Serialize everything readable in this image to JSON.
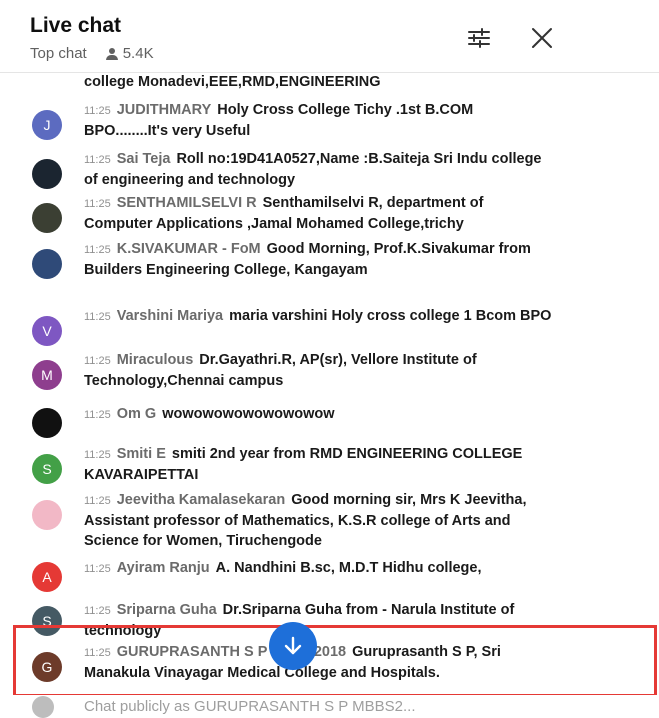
{
  "header": {
    "title": "Live chat",
    "mode": "Top chat",
    "viewers": "5.4K"
  },
  "messages": [
    {
      "time": "",
      "author": "",
      "text": "college   Monadevi,EEE,RMD,ENGINEERING",
      "avatar": null
    },
    {
      "time": "11:25",
      "author": "JUDITHMARY",
      "text": "Holy Cross College Tichy .1st B.COM BPO........It's very Useful",
      "avatar": {
        "letter": "J",
        "color": "#5c6bc0"
      }
    },
    {
      "time": "11:25",
      "author": "Sai Teja",
      "text": "Roll no:19D41A0527,Name :B.Saiteja Sri Indu college of engineering and technology",
      "avatar": {
        "letter": "",
        "color": "#1b2530"
      }
    },
    {
      "time": "11:25",
      "author": "SENTHAMILSELVI R",
      "text": "Senthamilselvi R, department of Computer Applications ,Jamal Mohamed College,trichy",
      "avatar": {
        "letter": "",
        "color": "#3b3f33"
      }
    },
    {
      "time": "11:25",
      "author": "K.SIVAKUMAR - FoM",
      "text": "Good Morning, Prof.K.Sivakumar from Builders Engineering College, Kangayam",
      "avatar": {
        "letter": "",
        "color": "#2f4a78"
      }
    },
    {
      "time": "11:25",
      "author": "Varshini Mariya",
      "text": "maria varshini Holy cross college 1 Bcom BPO",
      "avatar": {
        "letter": "V",
        "color": "#7e57c2"
      }
    },
    {
      "time": "11:25",
      "author": "Miraculous",
      "text": "Dr.Gayathri.R, AP(sr), Vellore Institute of Technology,Chennai campus",
      "avatar": {
        "letter": "M",
        "color": "#8e3e8e"
      }
    },
    {
      "time": "11:25",
      "author": "Om G",
      "text": "wowowowowowowowow",
      "avatar": {
        "letter": "",
        "color": "#111111"
      }
    },
    {
      "time": "11:25",
      "author": "Smiti E",
      "text": "smiti 2nd year from RMD ENGINEERING COLLEGE KAVARAIPETTAI",
      "avatar": {
        "letter": "S",
        "color": "#43a047"
      }
    },
    {
      "time": "11:25",
      "author": "Jeevitha Kamalasekaran",
      "text": "Good morning sir, Mrs K Jeevitha, Assistant professor of Mathematics, K.S.R college of Arts and Science for Women, Tiruchengode",
      "avatar": {
        "letter": "",
        "color": "#f2b8c6"
      }
    },
    {
      "time": "11:25",
      "author": "Ayiram Ranju",
      "text": "A. Nandhini B.sc, M.D.T Hidhu college,",
      "avatar": {
        "letter": "A",
        "color": "#e53935"
      }
    },
    {
      "time": "11:25",
      "author": "Sriparna Guha",
      "text": "Dr.Sriparna Guha from - Narula Institute of technology",
      "avatar": {
        "letter": "S",
        "color": "#455a64"
      }
    },
    {
      "time": "11:25",
      "author": "GURUPRASANTH S P MBBS2018",
      "text": "Guruprasanth S P, Sri Manakula Vinayagar Medical College and Hospitals.",
      "avatar": {
        "letter": "G",
        "color": "#6d3b2a"
      }
    }
  ],
  "input": {
    "placeholder": "Chat publicly as GURUPRASANTH S P MBBS2..."
  },
  "icons": {
    "filter": "filter-icon",
    "close": "close-icon",
    "scroll": "arrow-down-icon",
    "viewers": "person-icon",
    "emoji": "emoji-icon"
  },
  "colors": {
    "highlight": "#e53935",
    "scroll_button": "#1e6fd9"
  }
}
